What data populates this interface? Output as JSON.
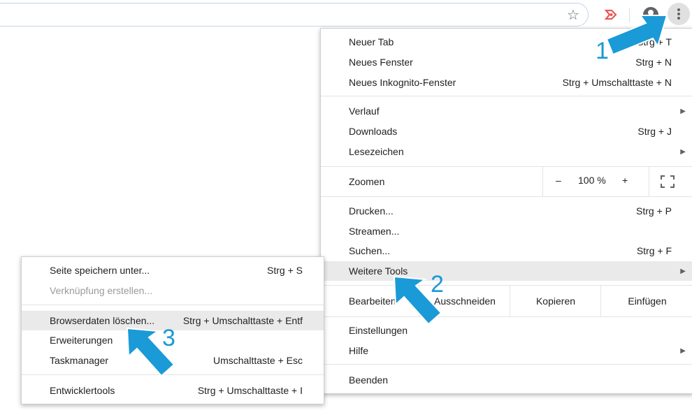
{
  "toolbar": {
    "bookmark_icon": "star-icon",
    "extension_icon": "extension-icon",
    "profile_icon": "avatar-icon",
    "menu_icon": "kebab-menu-icon",
    "accent": "#1a9ad6"
  },
  "main_menu": {
    "new_tab": {
      "label": "Neuer Tab",
      "shortcut": "Strg + T"
    },
    "new_window": {
      "label": "Neues Fenster",
      "shortcut": "Strg + N"
    },
    "incognito": {
      "label": "Neues Inkognito-Fenster",
      "shortcut": "Strg + Umschalttaste + N"
    },
    "history": {
      "label": "Verlauf"
    },
    "downloads": {
      "label": "Downloads",
      "shortcut": "Strg + J"
    },
    "bookmarks": {
      "label": "Lesezeichen"
    },
    "zoom": {
      "label": "Zoomen",
      "minus": "–",
      "value": "100 %",
      "plus": "+"
    },
    "print": {
      "label": "Drucken...",
      "shortcut": "Strg + P"
    },
    "cast": {
      "label": "Streamen..."
    },
    "find": {
      "label": "Suchen...",
      "shortcut": "Strg + F"
    },
    "more_tools": {
      "label": "Weitere Tools"
    },
    "edit": {
      "label": "Bearbeiten",
      "cut": "Ausschneiden",
      "copy": "Kopieren",
      "paste": "Einfügen"
    },
    "settings": {
      "label": "Einstellungen"
    },
    "help": {
      "label": "Hilfe"
    },
    "exit": {
      "label": "Beenden"
    }
  },
  "sub_menu": {
    "save_page": {
      "label": "Seite speichern unter...",
      "shortcut": "Strg + S"
    },
    "create_shortcut": {
      "label": "Verknüpfung erstellen..."
    },
    "clear_data": {
      "label": "Browserdaten löschen...",
      "shortcut": "Strg + Umschalttaste + Entf"
    },
    "extensions": {
      "label": "Erweiterungen"
    },
    "task_manager": {
      "label": "Taskmanager",
      "shortcut": "Umschalttaste + Esc"
    },
    "dev_tools": {
      "label": "Entwicklertools",
      "shortcut": "Strg + Umschalttaste + I"
    }
  },
  "callouts": {
    "one": "1",
    "two": "2",
    "three": "3"
  }
}
